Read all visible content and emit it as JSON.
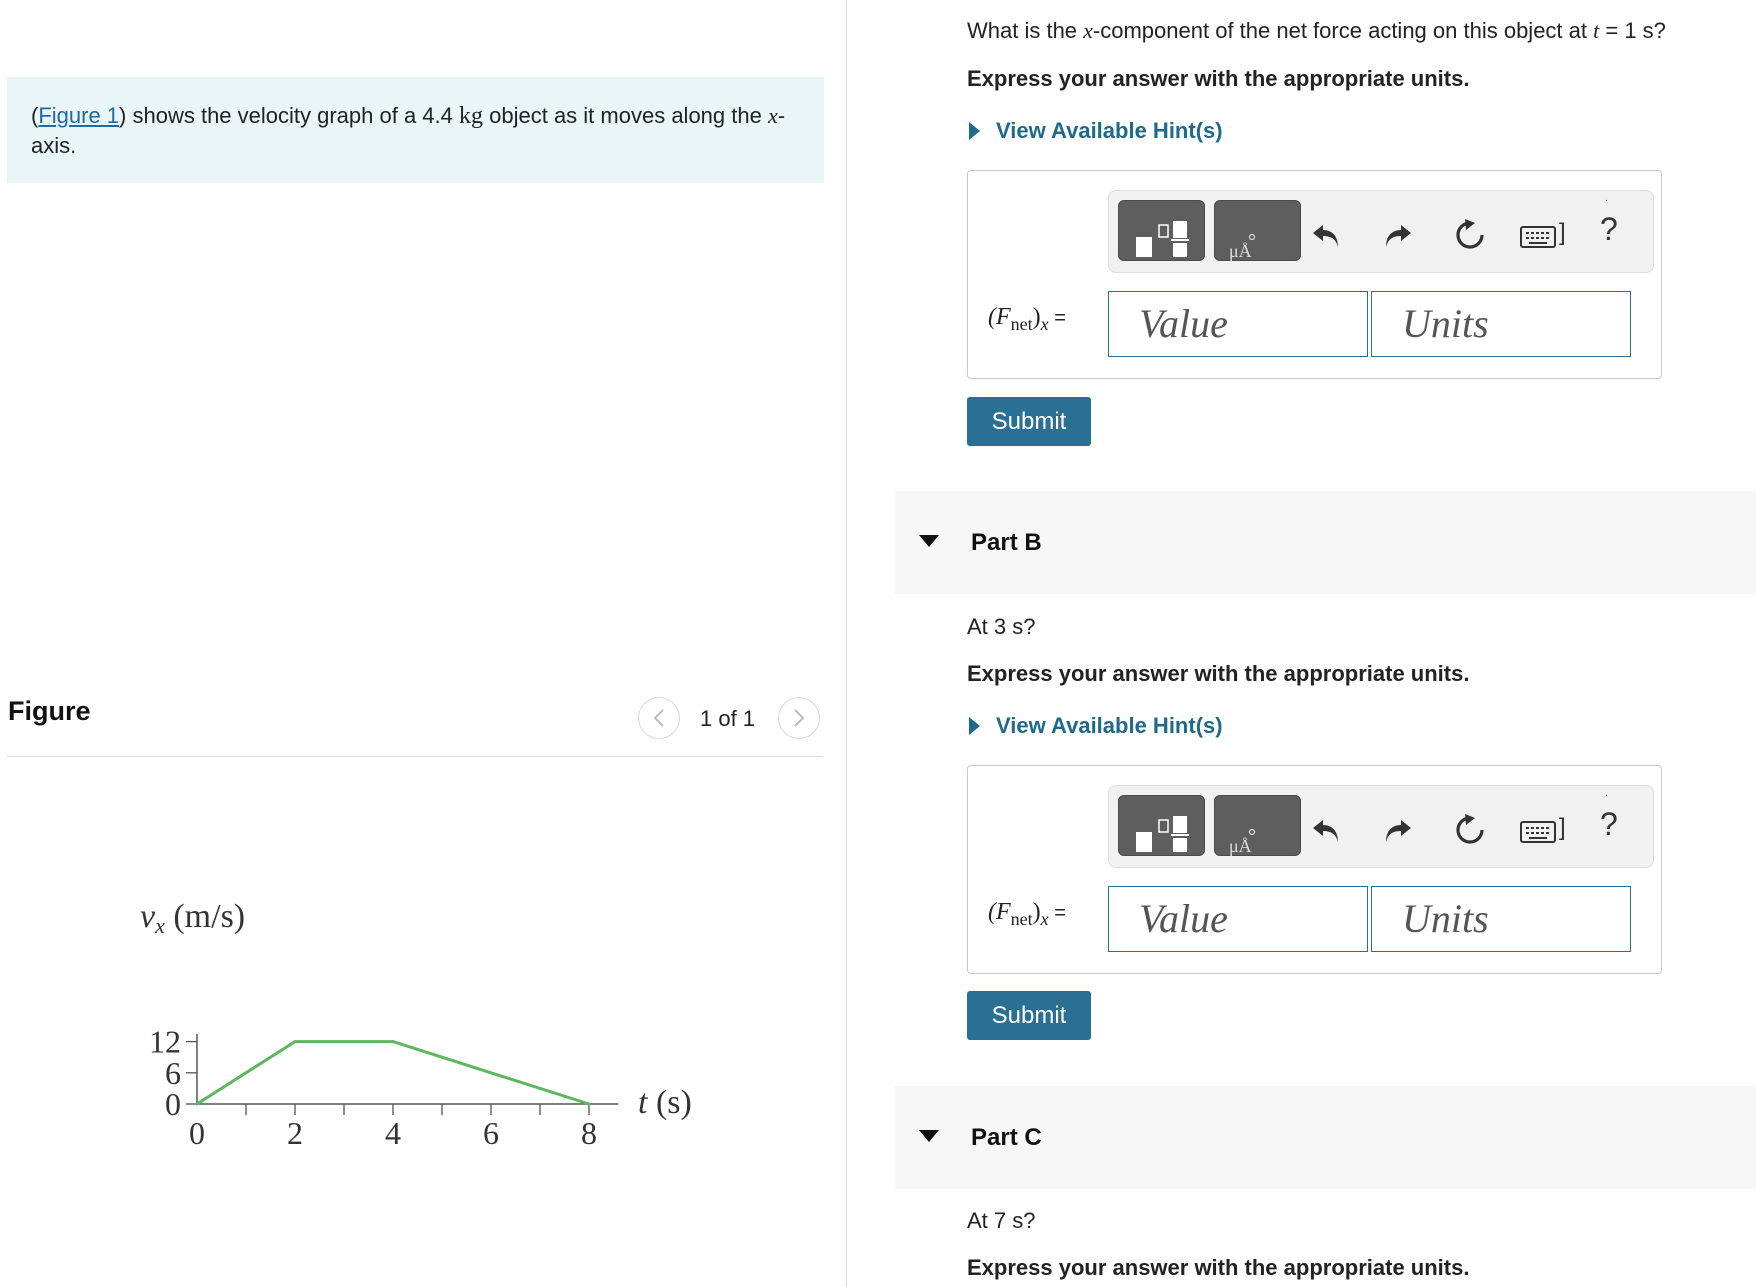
{
  "intro": {
    "open_paren": "(",
    "figure_link": "Figure 1",
    "text_1": ") shows the velocity graph of a 4.4 ",
    "unit_kg": "kg",
    "text_2": " object as it moves along the ",
    "var_x": "x",
    "text_3": "-axis."
  },
  "figure_panel": {
    "title": "Figure",
    "pager": "1 of 1"
  },
  "chart_data": {
    "type": "line",
    "ylabel": "vx (m/s)",
    "xlabel": "t (s)",
    "x_ticks": [
      "0",
      "2",
      "4",
      "6",
      "8"
    ],
    "y_ticks": [
      "0",
      "6",
      "12"
    ],
    "xlim": [
      0,
      8.6
    ],
    "ylim": [
      0,
      13.5
    ],
    "line_color": "#5cb85c",
    "series": [
      {
        "x": [
          0,
          2,
          4,
          8
        ],
        "y": [
          0,
          12,
          12,
          0
        ]
      }
    ]
  },
  "part_a": {
    "question_1": "What is the ",
    "var_x": "x",
    "question_2": "-component of the net force acting on this object at ",
    "var_t": "t",
    "question_3": " = 1 s?",
    "instruction": "Express your answer with the appropriate units.",
    "hint": "View Available Hint(s)",
    "eq_label_main": "(F",
    "eq_label_sub": "net",
    "eq_label_end": ")",
    "eq_label_x": "x",
    "eq_label_eq": " =",
    "value_placeholder": "Value",
    "units_placeholder": "Units",
    "submit": "Submit"
  },
  "part_b": {
    "label": "Part B",
    "question": "At 3 s?",
    "instruction": "Express your answer with the appropriate units.",
    "hint": "View Available Hint(s)",
    "eq_label_main": "(F",
    "eq_label_sub": "net",
    "eq_label_end": ")",
    "eq_label_x": "x",
    "eq_label_eq": " =",
    "value_placeholder": "Value",
    "units_placeholder": "Units",
    "submit": "Submit"
  },
  "part_c": {
    "label": "Part C",
    "question": "At 7 s?",
    "instruction": "Express your answer with the appropriate units."
  },
  "toolbar": {
    "help": "?",
    "keyboard_bar": "]",
    "units_glyph": "μÅ"
  },
  "colors": {
    "accent": "#2a6f94",
    "link": "#1f6aa0",
    "intro_bg": "#e9f5f7"
  }
}
